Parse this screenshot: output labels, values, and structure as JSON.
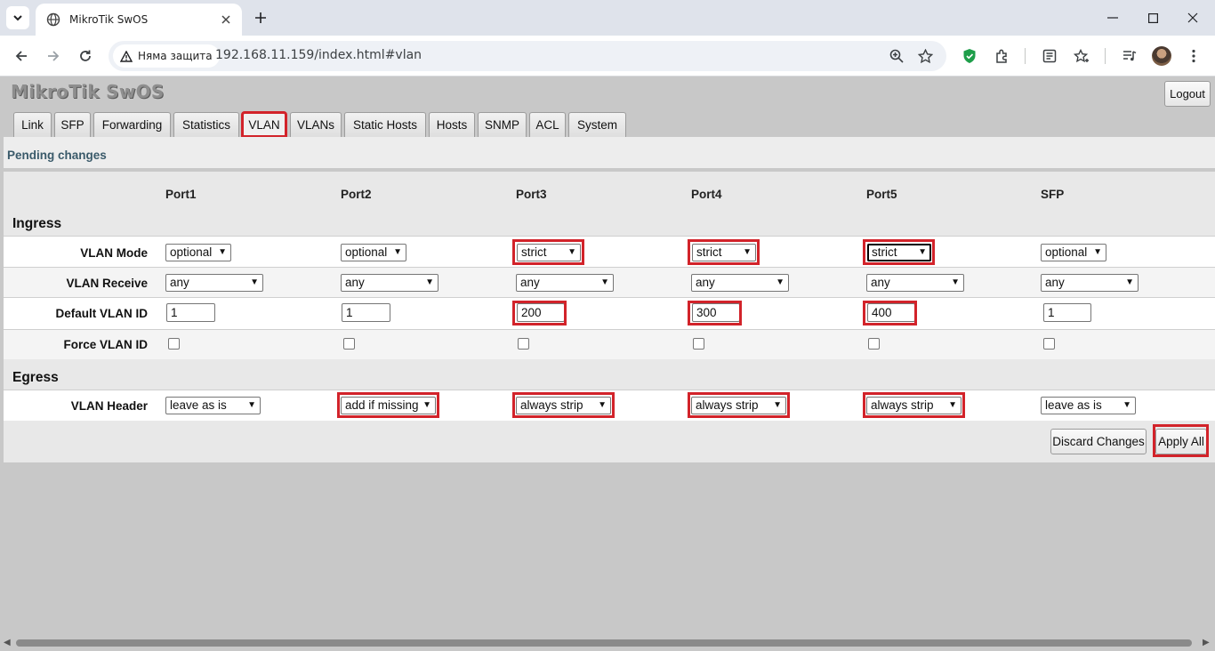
{
  "browser": {
    "tab_title": "MikroTik SwOS",
    "security_label": "Няма защита",
    "url": "192.168.11.159/index.html#vlan"
  },
  "app": {
    "brand": "MikroTik SwOS",
    "logout_label": "Logout",
    "nav_tabs": [
      "Link",
      "SFP",
      "Forwarding",
      "Statistics",
      "VLAN",
      "VLANs",
      "Static Hosts",
      "Hosts",
      "SNMP",
      "ACL",
      "System"
    ],
    "active_tab": "VLAN",
    "pending_label": "Pending changes"
  },
  "vlan_table": {
    "ports": [
      "Port1",
      "Port2",
      "Port3",
      "Port4",
      "Port5",
      "SFP"
    ],
    "ingress_title": "Ingress",
    "egress_title": "Egress",
    "labels": {
      "vlan_mode": "VLAN Mode",
      "vlan_receive": "VLAN Receive",
      "default_vlan_id": "Default VLAN ID",
      "force_vlan_id": "Force VLAN ID",
      "vlan_header": "VLAN Header"
    },
    "vlan_mode": [
      "optional",
      "optional",
      "strict",
      "strict",
      "strict",
      "optional"
    ],
    "vlan_receive": [
      "any",
      "any",
      "any",
      "any",
      "any",
      "any"
    ],
    "default_vlan_id": [
      "1",
      "1",
      "200",
      "300",
      "400",
      "1"
    ],
    "force_vlan_id": [
      false,
      false,
      false,
      false,
      false,
      false
    ],
    "vlan_header": [
      "leave as is",
      "add if missing",
      "always strip",
      "always strip",
      "always strip",
      "leave as is"
    ]
  },
  "actions": {
    "discard_label": "Discard Changes",
    "apply_label": "Apply All"
  },
  "colors": {
    "highlight": "#d2232a",
    "page_bg": "#c8c8c8",
    "brand_gray": "#8e8e8e"
  }
}
